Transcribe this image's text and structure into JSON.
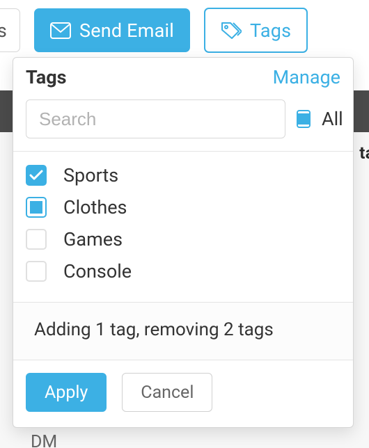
{
  "toolbar": {
    "partial_label": "ces",
    "send_email_label": "Send Email",
    "tags_label": "Tags"
  },
  "panel": {
    "title": "Tags",
    "manage_link": "Manage",
    "search_placeholder": "Search",
    "all_label": "All",
    "summary": "Adding 1 tag, removing 2 tags",
    "apply_label": "Apply",
    "cancel_label": "Cancel"
  },
  "tags": [
    {
      "label": "Sports",
      "state": "checked"
    },
    {
      "label": "Clothes",
      "state": "indeterminate"
    },
    {
      "label": "Games",
      "state": "unchecked"
    },
    {
      "label": "Console",
      "state": "unchecked"
    }
  ],
  "bg": {
    "right_text": "ta",
    "pm_text": "DM"
  }
}
